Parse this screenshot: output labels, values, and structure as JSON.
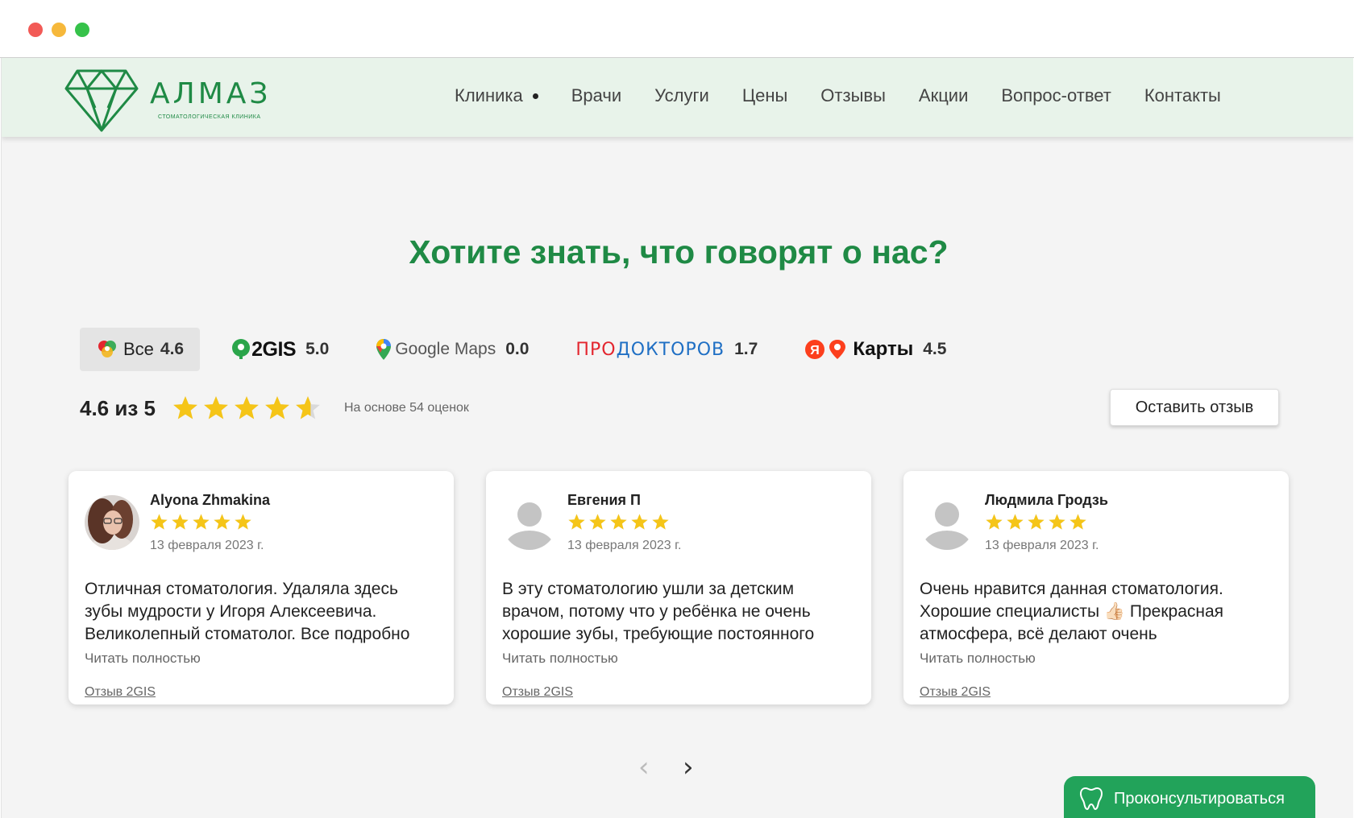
{
  "header": {
    "logo_text": "АЛМАЗ",
    "logo_subtitle": "стоматологическая клиника",
    "nav": [
      {
        "label": "Клиника",
        "has_dropdown": true
      },
      {
        "label": "Врачи"
      },
      {
        "label": "Услуги"
      },
      {
        "label": "Цены"
      },
      {
        "label": "Отзывы"
      },
      {
        "label": "Акции"
      },
      {
        "label": "Вопрос-ответ"
      },
      {
        "label": "Контакты"
      }
    ]
  },
  "reviews_section": {
    "title": "Хотите знать, что говорят о нас?",
    "tabs": [
      {
        "label": "Все",
        "score": "4.6",
        "icon": "all-sources-icon",
        "active": true
      },
      {
        "label": "2GIS",
        "score": "5.0",
        "icon": "2gis-icon"
      },
      {
        "label": "Google Maps",
        "score": "0.0",
        "icon": "google-maps-pin-icon"
      },
      {
        "label": "ПРОДОКТОРОВ",
        "score": "1.7",
        "icon": "prodoctorov-logo"
      },
      {
        "label": "Карты",
        "score": "4.5",
        "icon": "yandex-maps-icon"
      }
    ],
    "summary": {
      "rating_text": "4.6 из 5",
      "rating": 4.6,
      "max": 5,
      "based_on": "На основе 54 оценок"
    },
    "leave_review_button": "Оставить отзыв",
    "cards": [
      {
        "author": "Alyona Zhmakina",
        "stars": 5,
        "date": "13 февраля 2023 г.",
        "text": "Отличная стоматология. Удаляла здесь зубы мудрости у Игоря Алексеевича. Великолепный стоматолог. Все подробно",
        "read_more": "Читать полностью",
        "source": "Отзыв 2GIS",
        "avatar": "photo"
      },
      {
        "author": "Евгения П",
        "stars": 5,
        "date": "13 февраля 2023 г.",
        "text": "В эту стоматологию ушли за детским врачом, потому что у ребёнка не очень хорошие зубы, требующие постоянного",
        "read_more": "Читать полностью",
        "source": "Отзыв 2GIS",
        "avatar": "placeholder"
      },
      {
        "author": "Людмила Гродзь",
        "stars": 5,
        "date": "13 февраля 2023 г.",
        "text": "Очень нравится данная стоматология. Хорошие специалисты 👍🏻 Прекрасная атмосфера, всё делают очень",
        "read_more": "Читать полностью",
        "source": "Отзыв 2GIS",
        "avatar": "placeholder"
      }
    ],
    "pager": {
      "prev": "‹",
      "next": "›"
    }
  },
  "consult_button": {
    "label": "Проконсультироваться",
    "icon": "tooth-icon"
  },
  "colors": {
    "brand_green": "#1f8a45",
    "header_bg": "#e8f3ea",
    "page_bg": "#f4f4f4",
    "star": "#f5c518",
    "consult_bg": "#22a35a",
    "prodoctorov_red": "#e3262f",
    "prodoctorov_blue": "#1f6fc4"
  }
}
